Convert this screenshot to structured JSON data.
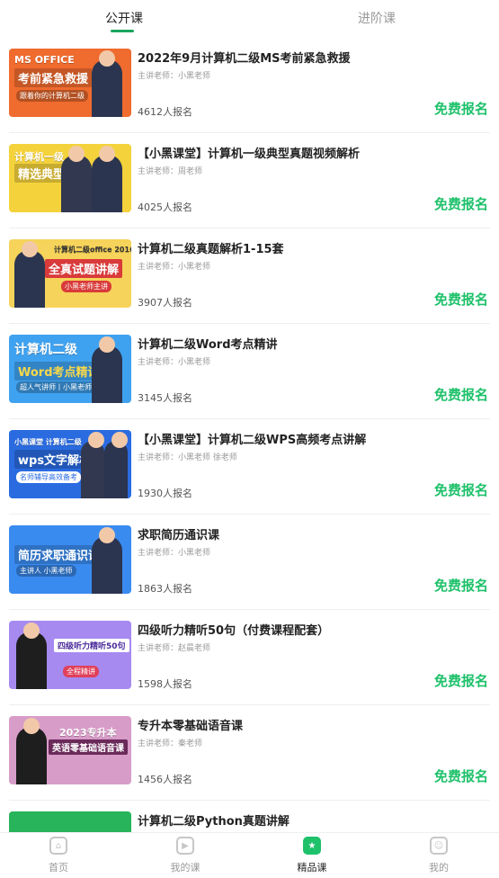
{
  "tabs": [
    {
      "label": "公开课"
    },
    {
      "label": "进阶课"
    }
  ],
  "courses": [
    {
      "title": "2022年9月计算机二级MS考前紧急救援",
      "teacher": "主讲老师：小黑老师",
      "count": "4612人报名",
      "signup": "免费报名",
      "thumb": {
        "line1": "MS OFFICE",
        "line2": "考前紧急救援",
        "line3": "跟着你的计算机二级",
        "bg": "#ef6b2e"
      }
    },
    {
      "title": "【小黑课堂】计算机一级典型真题视频解析",
      "teacher": "主讲老师：周老师",
      "count": "4025人报名",
      "signup": "免费报名",
      "thumb": {
        "line1": "计算机一级",
        "line2": "精选典型真题",
        "line3": "",
        "bg": "#f4d23c"
      }
    },
    {
      "title": "计算机二级真题解析1-15套",
      "teacher": "主讲老师：小黑老师",
      "count": "3907人报名",
      "signup": "免费报名",
      "thumb": {
        "line1": "计算机二级office 2016版",
        "line2": "全真试题讲解",
        "line3": "小黑老师主讲",
        "bg": "#f6d35a"
      }
    },
    {
      "title": "计算机二级Word考点精讲",
      "teacher": "主讲老师：小黑老师",
      "count": "3145人报名",
      "signup": "免费报名",
      "thumb": {
        "line1": "计算机二级",
        "line2": "Word考点精讲",
        "line3": "超人气讲师丨小黑老师",
        "bg": "#3fa2f0"
      }
    },
    {
      "title": "【小黑课堂】计算机二级WPS高频考点讲解",
      "teacher": "主讲老师：小黑老师 徐老师",
      "count": "1930人报名",
      "signup": "免费报名",
      "thumb": {
        "line1": "小黑课堂 计算机二级",
        "line2": "wps文字解析",
        "line3": "名师辅导高效备考",
        "bg": "#2a6be0"
      }
    },
    {
      "title": "求职简历通识课",
      "teacher": "主讲老师：小黑老师",
      "count": "1863人报名",
      "signup": "免费报名",
      "thumb": {
        "line1": "",
        "line2": "简历求职通识课",
        "line3": "主讲人 小黑老师",
        "bg": "#3a8bf0"
      }
    },
    {
      "title": "四级听力精听50句（付费课程配套）",
      "teacher": "主讲老师：赵晨老师",
      "count": "1598人报名",
      "signup": "免费报名",
      "thumb": {
        "line1": "",
        "line2": "四级听力精听50句",
        "line3": "全程精讲",
        "bg": "#a68af0"
      }
    },
    {
      "title": "专升本零基础语音课",
      "teacher": "主讲老师：秦老师",
      "count": "1456人报名",
      "signup": "免费报名",
      "thumb": {
        "line1": "2023专升本",
        "line2": "英语零基础语音课",
        "line3": "",
        "bg": "#d89cc8"
      }
    },
    {
      "title": "计算机二级Python真题讲解",
      "teacher": "",
      "count": "",
      "signup": "",
      "thumb": {
        "line1": "",
        "line2": "",
        "line3": "",
        "bg": "#27b45a"
      }
    }
  ],
  "nav": [
    {
      "label": "首页",
      "icon": "home-icon"
    },
    {
      "label": "我的课",
      "icon": "play-icon"
    },
    {
      "label": "精品课",
      "icon": "star-icon"
    },
    {
      "label": "我的",
      "icon": "smile-icon"
    }
  ]
}
